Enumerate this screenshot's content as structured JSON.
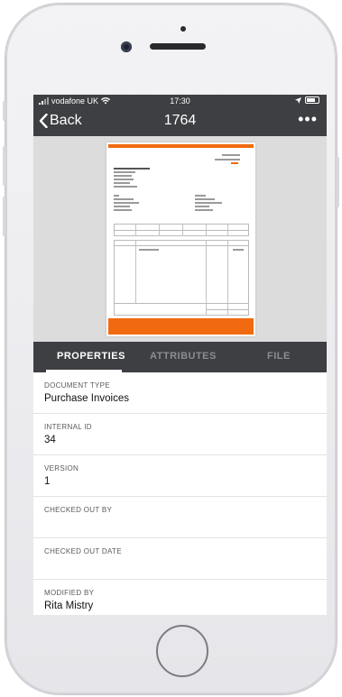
{
  "status_bar": {
    "carrier": "vodafone UK",
    "time": "17:30"
  },
  "nav": {
    "back_label": "Back",
    "title": "1764",
    "more_label": "•••"
  },
  "tabs": [
    {
      "label": "PROPERTIES",
      "active": true
    },
    {
      "label": "ATTRIBUTES",
      "active": false
    },
    {
      "label": "FILE",
      "active": false
    }
  ],
  "properties": [
    {
      "label": "DOCUMENT TYPE",
      "value": "Purchase Invoices"
    },
    {
      "label": "INTERNAL ID",
      "value": "34"
    },
    {
      "label": "VERSION",
      "value": "1"
    },
    {
      "label": "CHECKED OUT BY",
      "value": ""
    },
    {
      "label": "CHECKED OUT DATE",
      "value": ""
    },
    {
      "label": "MODIFIED BY",
      "value": "Rita Mistry"
    }
  ],
  "colors": {
    "nav_bg": "#3d3f42",
    "invoice_accent": "#f26a0f",
    "preview_bg": "#dcdcdc"
  },
  "icons": {
    "back": "chevron-left-icon",
    "more": "more-horizontal-icon",
    "wifi": "wifi-icon",
    "location": "location-arrow-icon",
    "battery": "battery-icon"
  }
}
